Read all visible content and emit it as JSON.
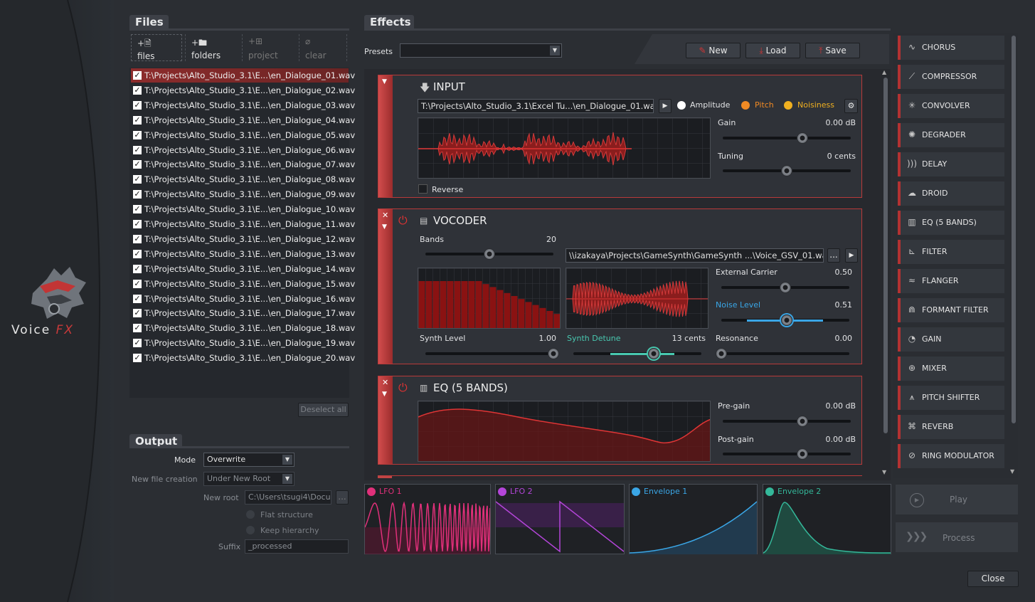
{
  "brand": {
    "name_part1": "Voice",
    "name_part2": "FX"
  },
  "files": {
    "tab": "Files",
    "toolbar": [
      {
        "icon": "+🗎",
        "label": "files"
      },
      {
        "icon": "+🖿",
        "label": "folders"
      },
      {
        "icon": "+⊞",
        "label": "project"
      },
      {
        "icon": "⌀",
        "label": "clear"
      }
    ],
    "items": [
      "T:\\Projects\\Alto_Studio_3.1\\E...\\en_Dialogue_01.wav",
      "T:\\Projects\\Alto_Studio_3.1\\E...\\en_Dialogue_02.wav",
      "T:\\Projects\\Alto_Studio_3.1\\E...\\en_Dialogue_03.wav",
      "T:\\Projects\\Alto_Studio_3.1\\E...\\en_Dialogue_04.wav",
      "T:\\Projects\\Alto_Studio_3.1\\E...\\en_Dialogue_05.wav",
      "T:\\Projects\\Alto_Studio_3.1\\E...\\en_Dialogue_06.wav",
      "T:\\Projects\\Alto_Studio_3.1\\E...\\en_Dialogue_07.wav",
      "T:\\Projects\\Alto_Studio_3.1\\E...\\en_Dialogue_08.wav",
      "T:\\Projects\\Alto_Studio_3.1\\E...\\en_Dialogue_09.wav",
      "T:\\Projects\\Alto_Studio_3.1\\E...\\en_Dialogue_10.wav",
      "T:\\Projects\\Alto_Studio_3.1\\E...\\en_Dialogue_11.wav",
      "T:\\Projects\\Alto_Studio_3.1\\E...\\en_Dialogue_12.wav",
      "T:\\Projects\\Alto_Studio_3.1\\E...\\en_Dialogue_13.wav",
      "T:\\Projects\\Alto_Studio_3.1\\E...\\en_Dialogue_14.wav",
      "T:\\Projects\\Alto_Studio_3.1\\E...\\en_Dialogue_15.wav",
      "T:\\Projects\\Alto_Studio_3.1\\E...\\en_Dialogue_16.wav",
      "T:\\Projects\\Alto_Studio_3.1\\E...\\en_Dialogue_17.wav",
      "T:\\Projects\\Alto_Studio_3.1\\E...\\en_Dialogue_18.wav",
      "T:\\Projects\\Alto_Studio_3.1\\E...\\en_Dialogue_19.wav",
      "T:\\Projects\\Alto_Studio_3.1\\E...\\en_Dialogue_20.wav"
    ],
    "check": "✓",
    "deselect_all": "Deselect all"
  },
  "output": {
    "tab": "Output",
    "mode_label": "Mode",
    "mode_value": "Overwrite",
    "new_file_label": "New file creation",
    "new_file_value": "Under New Root",
    "new_root_label": "New root",
    "new_root_value": "C:\\Users\\tsugi4\\Docu",
    "browse": "...",
    "flat": "Flat structure",
    "keep": "Keep hierarchy",
    "suffix_label": "Suffix",
    "suffix_value": "_processed"
  },
  "effects": {
    "tab": "Effects",
    "presets_label": "Presets",
    "new": "New",
    "load": "Load",
    "save": "Save",
    "input": {
      "title": "INPUT",
      "file": "T:\\Projects\\Alto_Studio_3.1\\Excel Tu...\\en_Dialogue_01.wav",
      "amplitude": "Amplitude",
      "pitch": "Pitch",
      "noisiness": "Noisiness",
      "gain_label": "Gain",
      "gain_value": "0.00 dB",
      "gain_pos": 0.62,
      "tuning_label": "Tuning",
      "tuning_value": "0 cents",
      "tuning_pos": 0.5,
      "reverse": "Reverse"
    },
    "vocoder": {
      "title": "VOCODER",
      "bands_label": "Bands",
      "bands_value": "20",
      "bands_pos": 0.5,
      "carrier_file": "\\\\izakaya\\Projects\\GameSynth\\GameSynth ...\\Voice_GSV_01.wav",
      "browse": "...",
      "ext_label": "External Carrier",
      "ext_value": "0.50",
      "ext_pos": 0.5,
      "noise_label": "Noise Level",
      "noise_value": "0.51",
      "noise_pos": 0.51,
      "synth_level_label": "Synth Level",
      "synth_level_value": "1.00",
      "synth_level_pos": 1.0,
      "detune_label": "Synth Detune",
      "detune_value": "13 cents",
      "detune_pos": 0.63,
      "res_label": "Resonance",
      "res_value": "0.00",
      "res_pos": 0.0
    },
    "eq": {
      "title": "EQ (5 BANDS)",
      "pregain_label": "Pre-gain",
      "pregain_value": "0.00 dB",
      "pregain_pos": 0.62,
      "postgain_label": "Post-gain",
      "postgain_value": "0.00 dB",
      "postgain_pos": 0.62
    }
  },
  "library": [
    {
      "icon": "∿",
      "name": "CHORUS"
    },
    {
      "icon": "⟋",
      "name": "COMPRESSOR"
    },
    {
      "icon": "✳",
      "name": "CONVOLVER"
    },
    {
      "icon": "✺",
      "name": "DEGRADER"
    },
    {
      "icon": ")))",
      "name": "DELAY"
    },
    {
      "icon": "☁",
      "name": "DROID"
    },
    {
      "icon": "▥",
      "name": "EQ (5 BANDS)"
    },
    {
      "icon": "⊾",
      "name": "FILTER"
    },
    {
      "icon": "≈",
      "name": "FLANGER"
    },
    {
      "icon": "⋒",
      "name": "FORMANT FILTER"
    },
    {
      "icon": "◔",
      "name": "GAIN"
    },
    {
      "icon": "⊕",
      "name": "MIXER"
    },
    {
      "icon": "⩚",
      "name": "PITCH SHIFTER"
    },
    {
      "icon": "⌘",
      "name": "REVERB"
    },
    {
      "icon": "⊘",
      "name": "RING MODULATOR"
    }
  ],
  "modulators": [
    {
      "name": "LFO 1",
      "color": "#e0307a"
    },
    {
      "name": "LFO 2",
      "color": "#b345d8"
    },
    {
      "name": "Envelope 1",
      "color": "#3aa6e6"
    },
    {
      "name": "Envelope 2",
      "color": "#34b89a"
    }
  ],
  "play": "Play",
  "process": "Process",
  "close": "Close",
  "colors": {
    "accent": "#c83a3a",
    "pitch": "#f08a24",
    "noisiness": "#f0b020",
    "noise_level": "#3aa6e6",
    "detune": "#48c8b0"
  }
}
